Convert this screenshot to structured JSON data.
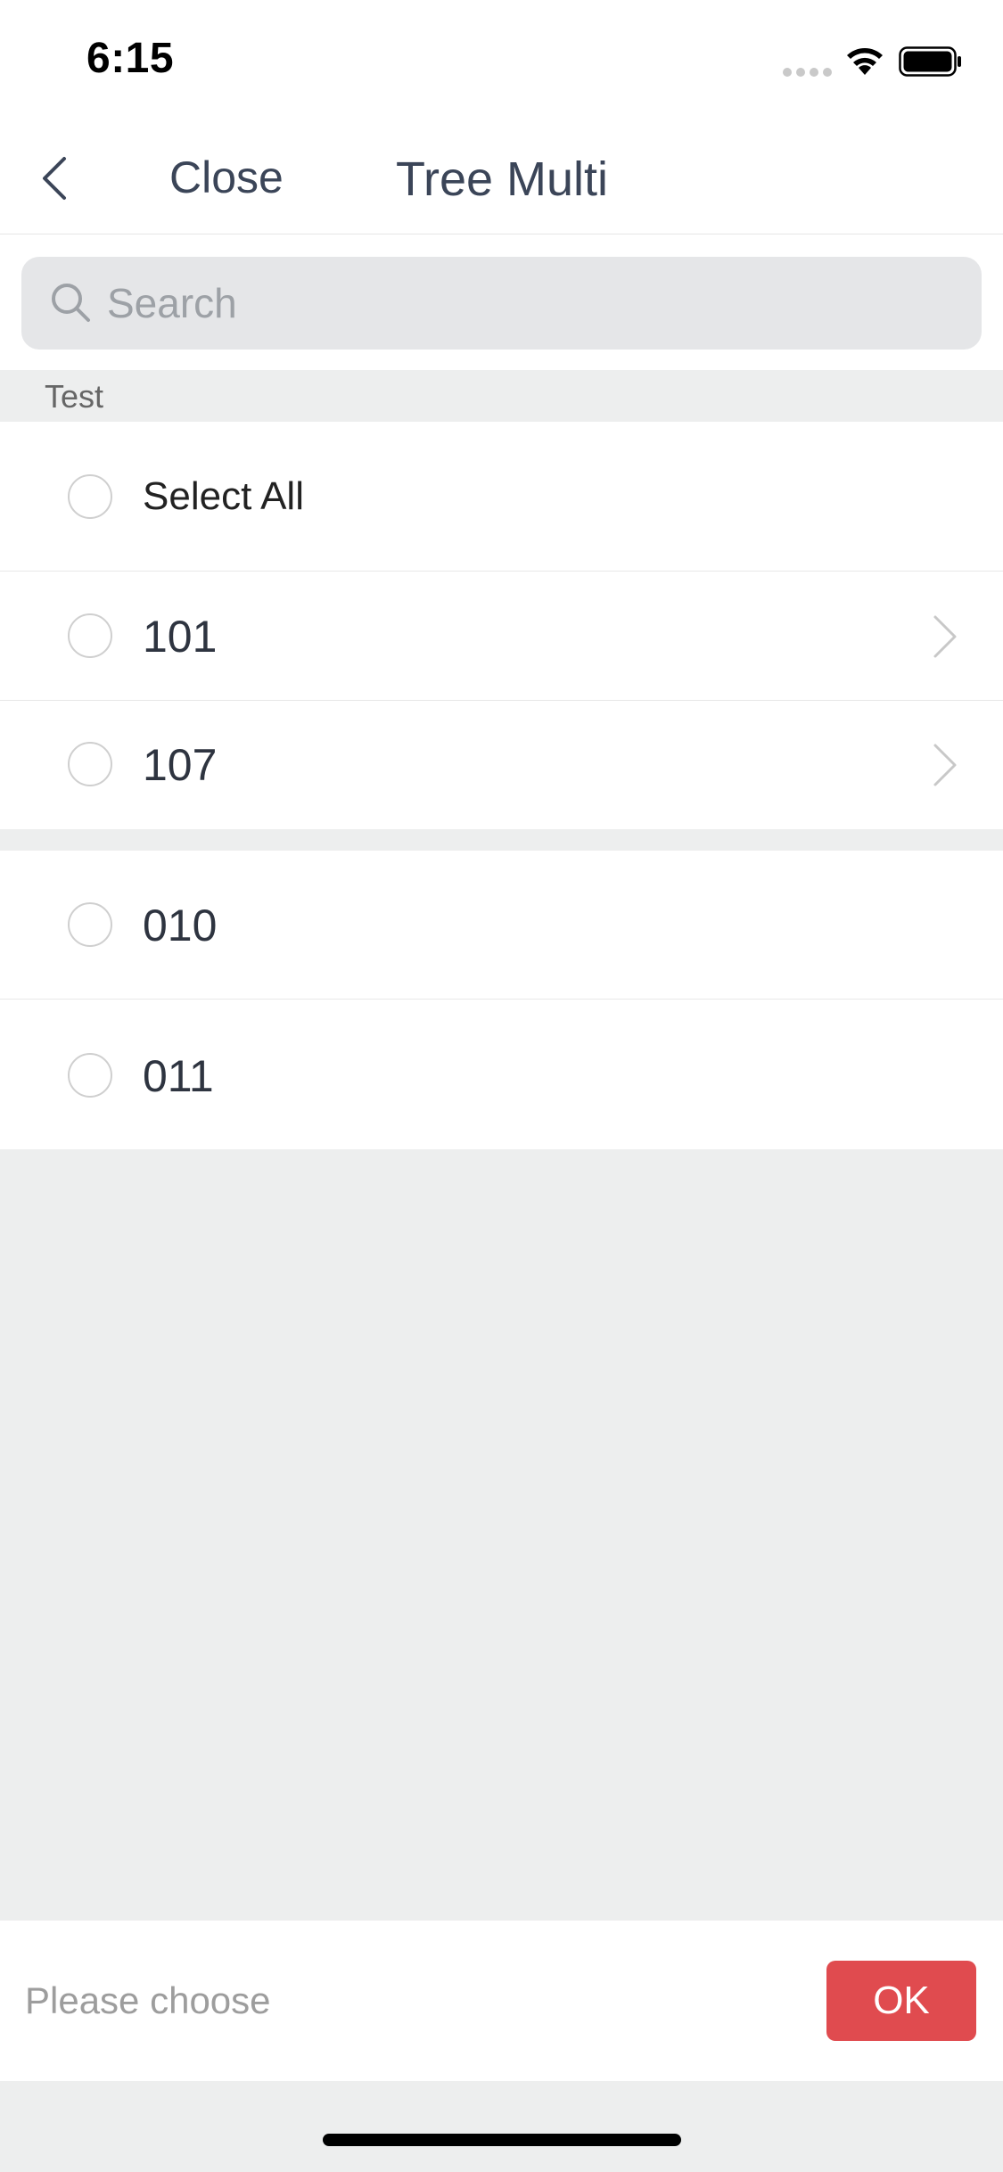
{
  "status_bar": {
    "time": "6:15",
    "icons": [
      "signal-icon",
      "wifi-icon",
      "battery-icon"
    ]
  },
  "nav": {
    "back_icon": "chevron-left-icon",
    "close_label": "Close",
    "title": "Tree Multi"
  },
  "search": {
    "icon": "search-icon",
    "placeholder": "Search",
    "value": ""
  },
  "section": {
    "label": "Test"
  },
  "items": [
    {
      "label": "Select All",
      "checked": false,
      "has_children": false
    },
    {
      "label": "101",
      "checked": false,
      "has_children": true
    },
    {
      "label": "107",
      "checked": false,
      "has_children": true
    },
    {
      "label": "010",
      "checked": false,
      "has_children": false
    },
    {
      "label": "011",
      "checked": false,
      "has_children": false
    }
  ],
  "footer": {
    "selection_text": "Please choose",
    "ok_label": "OK"
  },
  "colors": {
    "accent": "#e04b4f",
    "background": "#edeeee",
    "nav_text": "#3b4558"
  }
}
